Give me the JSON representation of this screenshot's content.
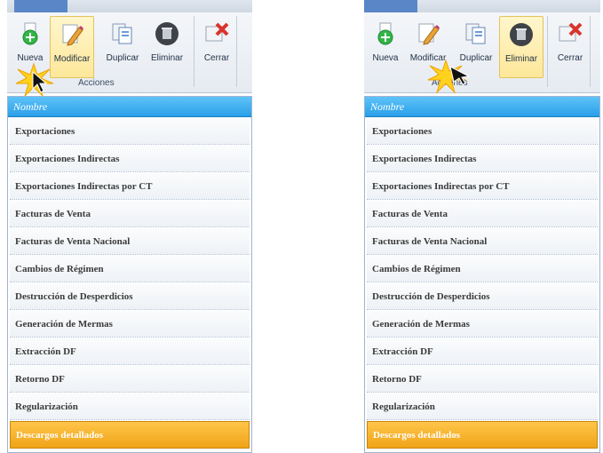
{
  "ribbon": {
    "buttons": [
      {
        "label": "Nueva",
        "icon": "new-plus-icon"
      },
      {
        "label": "Modificar",
        "icon": "edit-pencil-icon"
      },
      {
        "label": "Duplicar",
        "icon": "duplicate-icon"
      },
      {
        "label": "Eliminar",
        "icon": "trash-icon"
      },
      {
        "label": "Cerrar",
        "icon": "close-x-icon"
      }
    ],
    "group_label": "Acciones"
  },
  "list": {
    "header": "Nombre",
    "items": [
      "Exportaciones",
      "Exportaciones Indirectas",
      "Exportaciones Indirectas por CT",
      "Facturas de Venta",
      "Facturas de Venta Nacional",
      "Cambios de Régimen",
      "Destrucción de Desperdicios",
      "Generación de Mermas",
      "Extracción DF",
      "Retorno DF",
      "Regularización",
      "Descargos detallados"
    ],
    "selected_item": "Descargos detallados"
  },
  "colors": {
    "header_blue": "#2a9fe8",
    "selection_orange": "#f0a418",
    "highlight_yellow": "#fde79a"
  }
}
